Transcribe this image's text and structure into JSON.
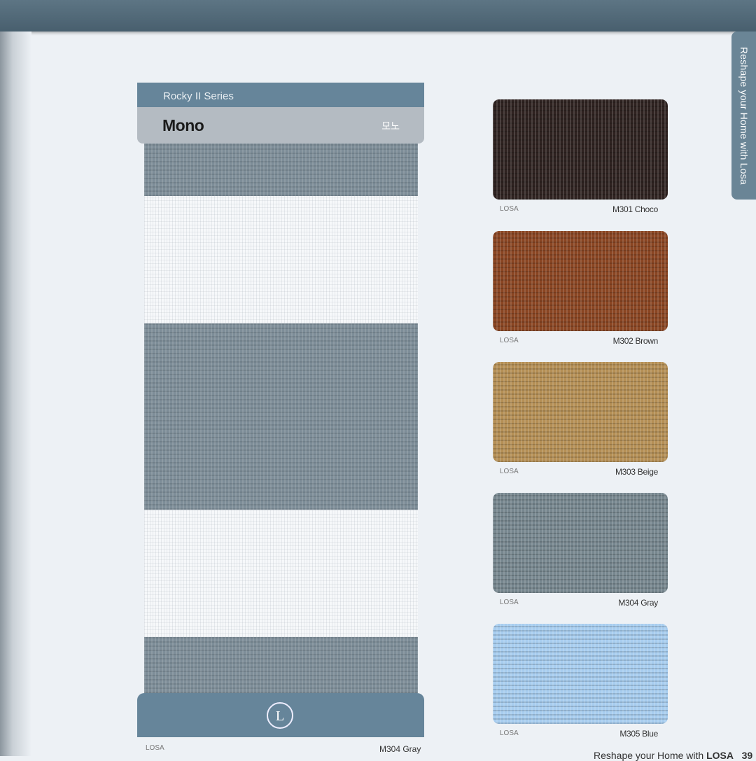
{
  "side_tab": "Reshape your Home with Losa",
  "panel": {
    "series": "Rocky II Series",
    "title": "Mono",
    "korean": "모노",
    "brand": "LOSA",
    "code": "M304 Gray",
    "logo_letter": "L"
  },
  "swatches": [
    {
      "brand": "LOSA",
      "code": "M301 Choco",
      "color": "#2e2220"
    },
    {
      "brand": "LOSA",
      "code": "M302 Brown",
      "color": "#8a4522"
    },
    {
      "brand": "LOSA",
      "code": "M303 Beige",
      "color": "#b58f55"
    },
    {
      "brand": "LOSA",
      "code": "M304 Gray",
      "color": "#77878f"
    },
    {
      "brand": "LOSA",
      "code": "M305 Blue",
      "color": "#a7cdef"
    }
  ],
  "footer": {
    "text": "Reshape your Home with ",
    "brand": "LOSA",
    "page": "39"
  }
}
